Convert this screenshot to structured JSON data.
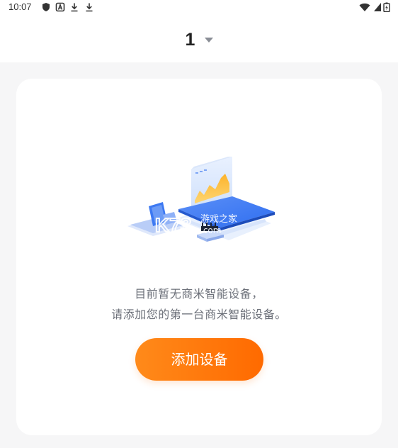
{
  "status_bar": {
    "time": "10:07",
    "icons_left": [
      "shield-icon",
      "a-badge-icon",
      "download-icon",
      "download-icon"
    ],
    "icons_right": [
      "wifi-icon",
      "signal-icon",
      "battery-icon"
    ]
  },
  "header": {
    "title": "1",
    "dropdown_icon": "caret-down-icon"
  },
  "empty_state": {
    "illustration": "devices-illustration",
    "watermark": {
      "logo": "K73",
      "text": "游戏之家",
      "domain": ".com"
    },
    "line1": "目前暂无商米智能设备，",
    "line2": "请添加您的第一台商米智能设备。",
    "add_button_label": "添加设备"
  },
  "colors": {
    "accent": "#ff7a0f",
    "background": "#f6f6f7",
    "card": "#ffffff",
    "text_secondary": "#6b6f78"
  }
}
